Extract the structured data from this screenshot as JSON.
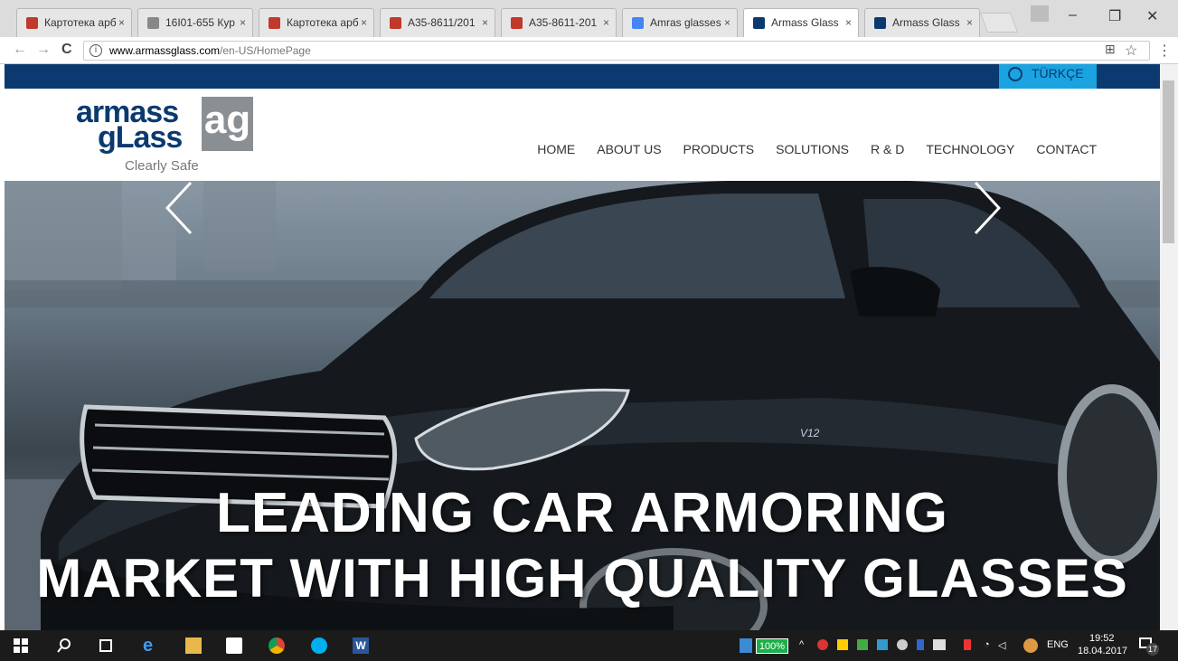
{
  "browser": {
    "tabs": [
      {
        "label": "Картотека арб",
        "fav_color": "#c0392b"
      },
      {
        "label": "16I01-655 Кур",
        "fav_color": "#888888"
      },
      {
        "label": "Картотека арб",
        "fav_color": "#c0392b"
      },
      {
        "label": "А35-8611/201",
        "fav_color": "#c0392b"
      },
      {
        "label": "А35-8611-201",
        "fav_color": "#c0392b"
      },
      {
        "label": "Amras glasses",
        "fav_color": "#4285f4"
      },
      {
        "label": "Armass Glass",
        "fav_color": "#0a3a70"
      },
      {
        "label": "Armass Glass",
        "fav_color": "#0a3a70"
      }
    ],
    "close_glyph": "×",
    "url_host": "www.armassglass.com",
    "url_path": "/en-US/HomePage",
    "info_glyph": "i",
    "window": {
      "minimize": "–",
      "maximize": "❐",
      "close": "✕"
    },
    "nav": {
      "back": "←",
      "forward": "→",
      "reload": "C"
    },
    "toolbar": {
      "translate": "⊞",
      "star": "☆",
      "menu": "⋮"
    }
  },
  "site": {
    "language_label": "TÜRKÇE",
    "logo": {
      "word1": "armass",
      "word2": "gLass",
      "badge": "ag",
      "tagline": "Clearly Safe"
    },
    "nav_items": [
      "HOME",
      "ABOUT US",
      "PRODUCTS",
      "SOLUTIONS",
      "R & D",
      "TECHNOLOGY",
      "CONTACT"
    ],
    "hero": {
      "line1": "LEADING CAR ARMORING",
      "line2": "MARKET WITH HIGH QUALITY GLASSES",
      "car_badge": "V12"
    },
    "colors": {
      "brand_blue": "#0a3a70",
      "lang_blue": "#1aa3e0",
      "logo_gray": "#8a8f94"
    }
  },
  "taskbar": {
    "battery": "100%",
    "language": "ENG",
    "time": "19:52",
    "date": "18.04.2017",
    "notifications": "17"
  }
}
